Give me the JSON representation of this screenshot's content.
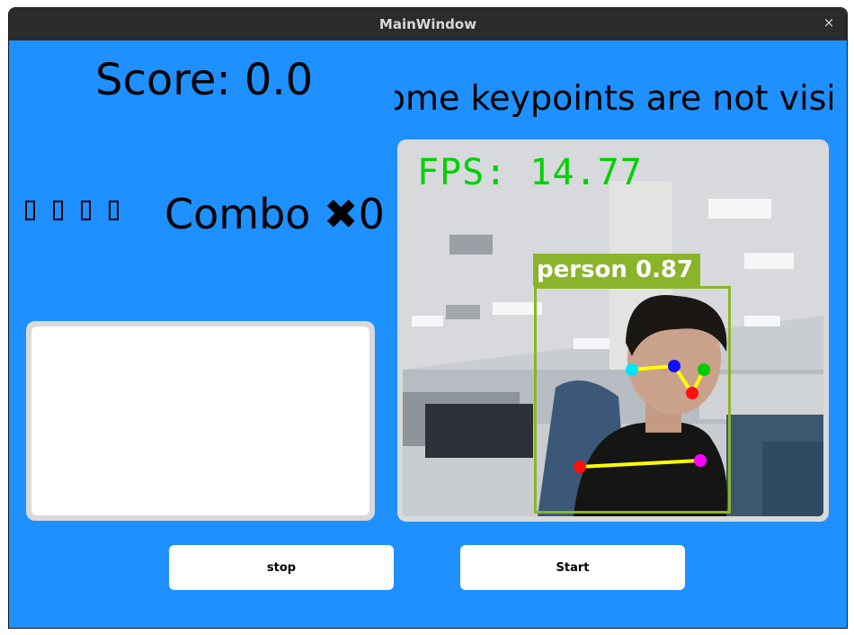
{
  "window": {
    "title": "MainWindow",
    "close_glyph": "×",
    "background": "#1e90ff"
  },
  "score": {
    "text": "Score: 0.0"
  },
  "status": {
    "lead": "›",
    "message": "Some keypoints are not visi"
  },
  "stars": {
    "count": 4,
    "glyph_names": [
      "missing-glyph-box",
      "missing-glyph-box",
      "missing-glyph-box",
      "missing-glyph-box"
    ]
  },
  "combo": {
    "text": "Combo ✖0"
  },
  "video": {
    "fps_text": "FPS: 14.77",
    "detection_label": "person 0.87",
    "detection_color": "#8ab52a",
    "fps_color": "#00d000",
    "keypoint_colors": [
      "#00e5ff",
      "#1010ff",
      "#00cc00",
      "#ff1010",
      "#ff1010",
      "#ff00ff"
    ],
    "skeleton_color": "#ffff00"
  },
  "buttons": {
    "stop": "stop",
    "start": "Start"
  }
}
